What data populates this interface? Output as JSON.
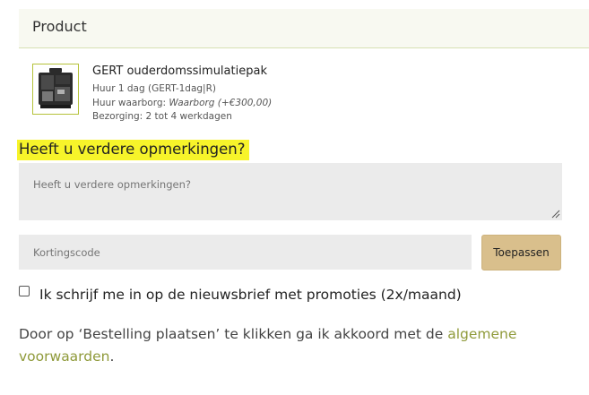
{
  "product_section": {
    "header": "Product",
    "item": {
      "name": "GERT ouderdomssimulatiepak",
      "rent": "Huur 1 dag (GERT-1dag|R)",
      "deposit_label": "Huur waarborg:",
      "deposit_value": "Waarborg (+€300,00)",
      "delivery": "Bezorging: 2 tot 4 werkdagen",
      "thumbnail_icon": "product-case-image"
    }
  },
  "remarks": {
    "heading": "Heeft u verdere opmerkingen?",
    "placeholder": "Heeft u verdere opmerkingen?"
  },
  "coupon": {
    "placeholder": "Kortingscode",
    "button_label": "Toepassen"
  },
  "newsletter": {
    "label": "Ik schrijf me in op de nieuwsbrief met promoties (2x/maand)",
    "checked": false
  },
  "terms": {
    "text_before": "Door op ‘Bestelling plaatsen’ te klikken ga ik akkoord met de ",
    "link_text": "algemene voorwaarden",
    "text_after": "."
  },
  "colors": {
    "highlight": "#f7f42a",
    "header_bg": "#f8f9f1",
    "link": "#8f9a3a",
    "button_bg": "#d9bf8c",
    "input_bg": "#ebebeb"
  }
}
